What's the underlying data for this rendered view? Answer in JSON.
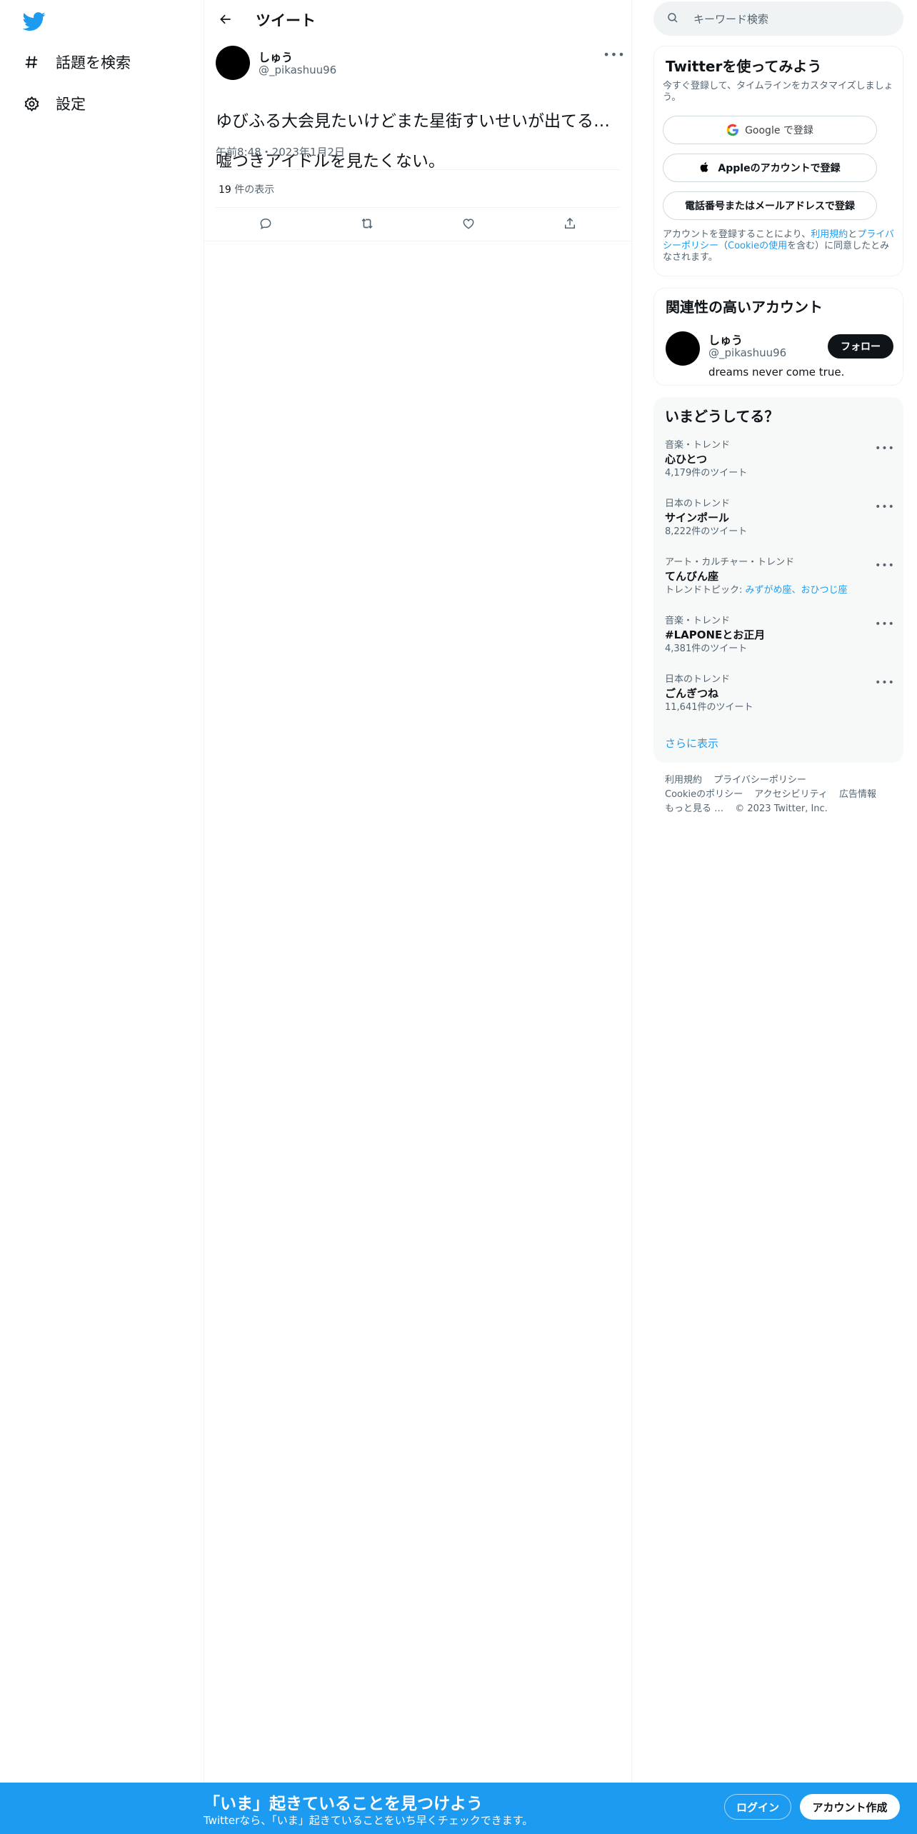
{
  "colors": {
    "accent": "#1d9bf0",
    "text": "#0f1419",
    "muted": "#536471",
    "border": "#eff3f4",
    "panel": "#f7f9f9"
  },
  "nav": {
    "logo_icon": "twitter-bird-icon",
    "items": [
      {
        "icon": "hashtag-icon",
        "label": "話題を検索"
      },
      {
        "icon": "gear-icon",
        "label": "設定"
      }
    ]
  },
  "main": {
    "header_title": "ツイート",
    "tweet": {
      "author_name": "しゅう",
      "author_handle": "@_pikashuu96",
      "text_line1": "ゆびふる大会見たいけどまた星街すいせいが出てる…",
      "text_line2": "嘘つきアイドルを見たくない。",
      "timestamp": "午前8:48・2023年1月2日",
      "views_count": "19",
      "views_label": " 件の表示"
    }
  },
  "search": {
    "placeholder": "キーワード検索"
  },
  "signup_card": {
    "title": "Twitterを使ってみよう",
    "subtitle": "今すぐ登録して、タイムラインをカスタマイズしましょう。",
    "google_label": "Google で登録",
    "apple_label": "Appleのアカウントで登録",
    "phone_email_label": "電話番号またはメールアドレスで登録",
    "terms_prefix": "アカウントを登録することにより、",
    "terms_link": "利用規約",
    "terms_and": "と",
    "privacy_link": "プライバシーポリシー",
    "cookie_open": "（",
    "cookie_link": "Cookieの使用",
    "terms_suffix": "を含む）に同意したとみなされます。"
  },
  "related_card": {
    "title": "関連性の高いアカウント",
    "name": "しゅう",
    "handle": "@_pikashuu96",
    "bio": "dreams never come true.",
    "follow_label": "フォロー"
  },
  "trends_card": {
    "title": "いまどうしてる？",
    "items": [
      {
        "context": "音楽・トレンド",
        "name": "心ひとつ",
        "count": "4,179件のツイート"
      },
      {
        "context": "日本のトレンド",
        "name": "サインポール",
        "count": "8,222件のツイート"
      },
      {
        "context": "アート・カルチャー・トレンド",
        "name": "てんびん座",
        "count_prefix": "トレンドトピック: ",
        "count_link": "みずがめ座、おひつじ座"
      },
      {
        "context": "音楽・トレンド",
        "name": "#LAPONEとお正月",
        "count": "4,381件のツイート"
      },
      {
        "context": "日本のトレンド",
        "name": "ごんぎつね",
        "count": "11,641件のツイート"
      }
    ],
    "show_more": "さらに表示"
  },
  "footer": {
    "links": [
      "利用規約",
      "プライバシーポリシー",
      "Cookieのポリシー",
      "アクセシビリティ",
      "広告情報",
      "もっと見る …"
    ],
    "copyright": "© 2023 Twitter, Inc."
  },
  "bottom_bar": {
    "title": "「いま」起きていることを見つけよう",
    "subtitle": "Twitterなら、「いま」起きていることをいち早くチェックできます。",
    "login_label": "ログイン",
    "signup_label": "アカウント作成"
  }
}
